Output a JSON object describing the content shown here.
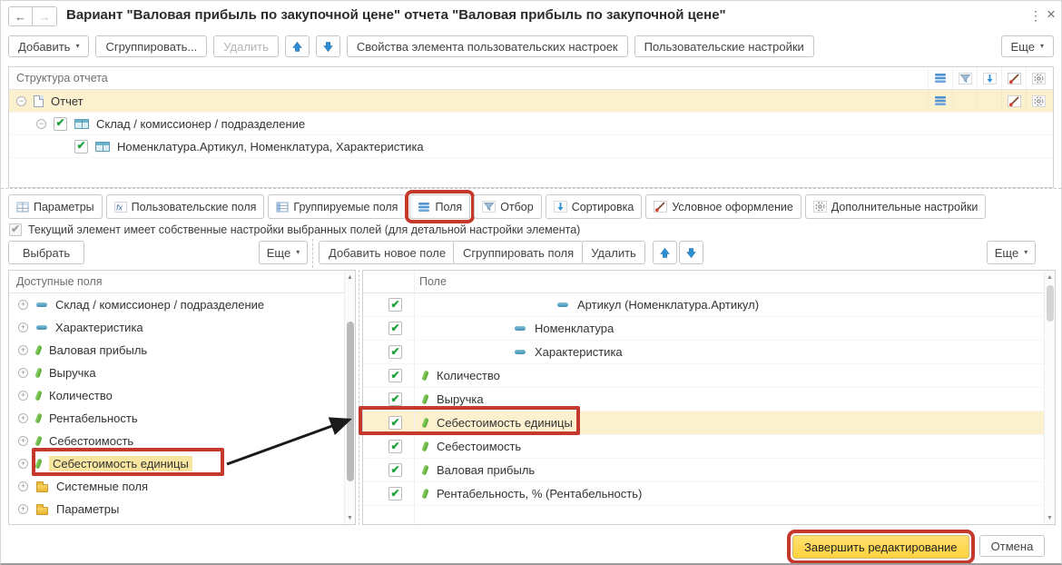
{
  "window": {
    "title": "Вариант \"Валовая прибыль по закупочной цене\" отчета \"Валовая прибыль по закупочной цене\""
  },
  "icons": {
    "back": "←",
    "forward": "→",
    "kebab": "⋮",
    "close": "×",
    "caret": "▾",
    "check": "✔",
    "collapse": "−",
    "expand": "+",
    "scroll_up": "▲",
    "scroll_down": "▼"
  },
  "toolbar": {
    "add": "Добавить",
    "group": "Сгруппировать...",
    "delete": "Удалить",
    "props": "Свойства элемента пользовательских настроек",
    "user_settings": "Пользовательские настройки",
    "more": "Еще"
  },
  "structure": {
    "header": "Структура отчета",
    "rows": [
      {
        "label": "Отчет"
      },
      {
        "label": "Склад / комиссионер / подразделение"
      },
      {
        "label": "Номенклатура.Артикул, Номенклатура, Характеристика"
      }
    ]
  },
  "tabs": [
    {
      "label": "Параметры"
    },
    {
      "label": "Пользовательские поля"
    },
    {
      "label": "Группируемые поля"
    },
    {
      "label": "Поля",
      "active": true
    },
    {
      "label": "Отбор"
    },
    {
      "label": "Сортировка"
    },
    {
      "label": "Условное оформление"
    },
    {
      "label": "Дополнительные настройки"
    }
  ],
  "fields_pane": {
    "own_settings_note": "Текущий элемент имеет собственные настройки выбранных полей (для детальной настройки элемента)",
    "select_button": "Выбрать",
    "more_left": "Еще",
    "add_new_field": "Добавить новое поле",
    "group_fields": "Сгруппировать поля",
    "delete": "Удалить",
    "more_right": "Еще"
  },
  "available_fields": {
    "header": "Доступные поля",
    "items": [
      {
        "label": "Склад / комиссионер / подразделение"
      },
      {
        "label": "Характеристика"
      },
      {
        "label": "Валовая прибыль"
      },
      {
        "label": "Выручка"
      },
      {
        "label": "Количество"
      },
      {
        "label": "Рентабельность"
      },
      {
        "label": "Себестоимость"
      },
      {
        "label": "Себестоимость единицы",
        "highlighted": true
      },
      {
        "label": "Системные поля"
      },
      {
        "label": "Параметры"
      }
    ]
  },
  "selected_fields": {
    "header": "Поле",
    "items": [
      {
        "label": "Артикул (Номенклатура.Артикул)",
        "checked": true
      },
      {
        "label": "Номенклатура",
        "checked": true
      },
      {
        "label": "Характеристика",
        "checked": true
      },
      {
        "label": "Количество",
        "checked": true
      },
      {
        "label": "Выручка",
        "checked": true
      },
      {
        "label": "Себестоимость единицы",
        "checked": true,
        "highlighted": true
      },
      {
        "label": "Себестоимость",
        "checked": true
      },
      {
        "label": "Валовая прибыль",
        "checked": true
      },
      {
        "label": "Рентабельность, % (Рентабельность)",
        "checked": true
      }
    ]
  },
  "footer": {
    "finish": "Завершить редактирование",
    "cancel": "Отмена"
  },
  "colors": {
    "annotation_red": "#C4392B",
    "finish_button_yellow": "#FFD23E",
    "row_highlight_yellow": "#FBF1CE",
    "check_green": "#1FA23C",
    "nav_arrow_blue": "#2E8FD5"
  }
}
